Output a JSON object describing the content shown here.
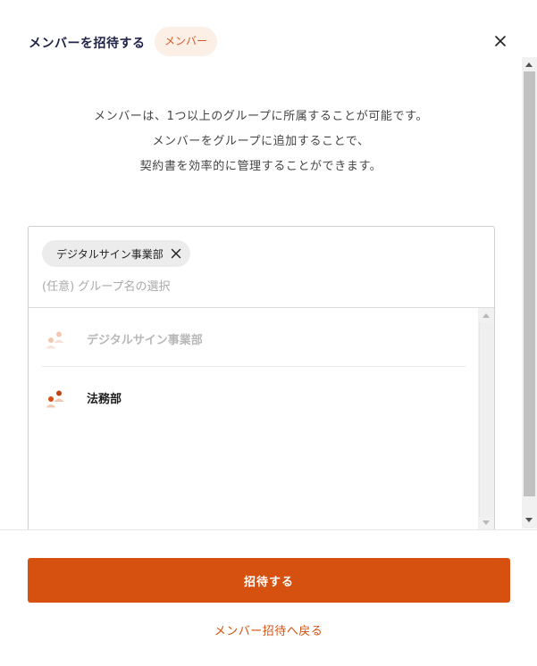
{
  "header": {
    "title": "メンバーを招待する",
    "role_badge": "メンバー",
    "close_icon": "close-icon"
  },
  "description": {
    "line1": "メンバーは、1つ以上のグループに所属することが可能です。",
    "line2": "メンバーをグループに追加することで、",
    "line3": "契約書を効率的に管理することができます。"
  },
  "group_select": {
    "selected": [
      {
        "label": "デジタルサイン事業部"
      }
    ],
    "placeholder": "(任意) グループ名の選択",
    "value": "",
    "options": [
      {
        "label": "デジタルサイン事業部",
        "disabled": true,
        "icon": "group-icon"
      },
      {
        "label": "法務部",
        "disabled": false,
        "icon": "group-icon"
      }
    ]
  },
  "footer": {
    "invite_button": "招待する",
    "back_link": "メンバー招待へ戻る"
  },
  "colors": {
    "accent": "#d6500f",
    "badge_bg": "#fbefe6",
    "badge_text": "#d85a2a",
    "title": "#1f2347"
  }
}
